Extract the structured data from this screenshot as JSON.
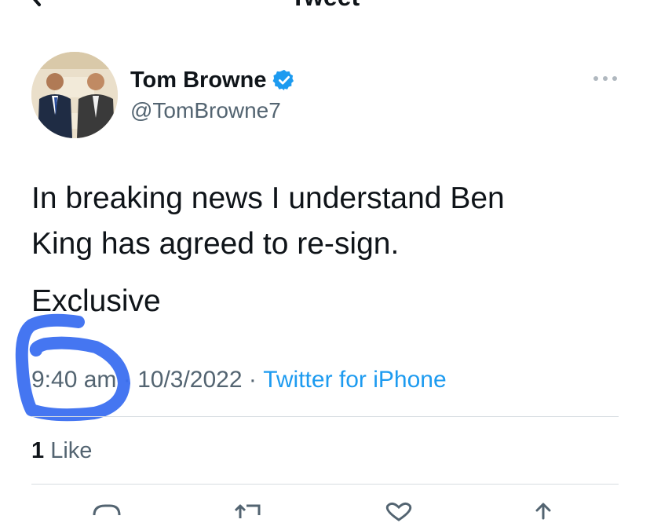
{
  "header": {
    "title": "Tweet"
  },
  "author": {
    "name": "Tom Browne",
    "handle": "@TomBrowne7",
    "verified": true,
    "avatar_icon": "profile-photo"
  },
  "tweet": {
    "text": "In breaking news I understand Ben\nKing has agreed to re-sign.",
    "text2": "Exclusive",
    "time": "9:40 am",
    "separator": " · ",
    "date": "10/3/2022",
    "source": "Twitter for iPhone"
  },
  "stats": {
    "like_count": "1",
    "like_label": " Like"
  },
  "colors": {
    "accent": "#1d9bf0",
    "muted": "#536471",
    "text": "#0f1419",
    "scribble": "#3b6ff0"
  },
  "icons": [
    "back-arrow-icon",
    "verified-badge-icon",
    "more-icon",
    "reply-icon",
    "retweet-icon",
    "like-icon",
    "share-icon"
  ]
}
